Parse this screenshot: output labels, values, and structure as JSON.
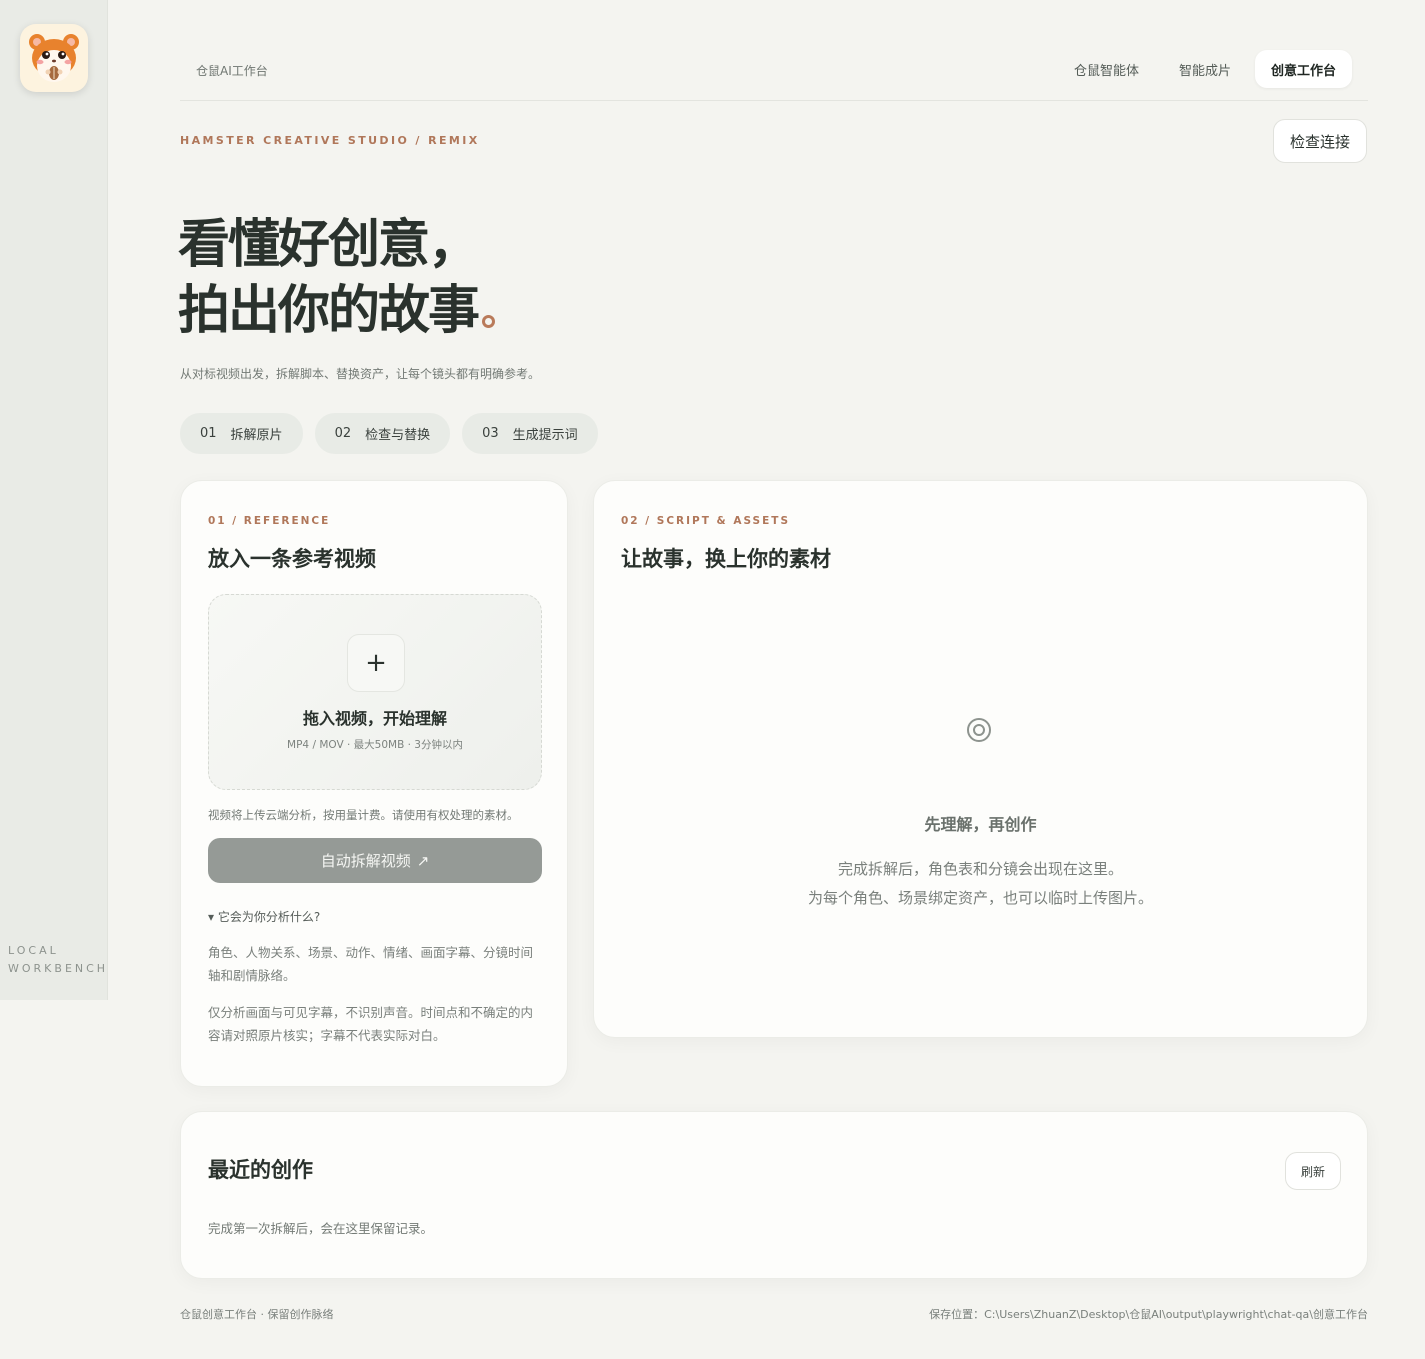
{
  "sidebar": {
    "logo_icon": "hamster-mascot-icon",
    "label_line1": "LOCAL",
    "label_line2": "WORKBENCH"
  },
  "topbar": {
    "brand": "仓鼠AI工作台",
    "nav": [
      {
        "label": "仓鼠智能体",
        "active": false
      },
      {
        "label": "智能成片",
        "active": false
      },
      {
        "label": "创意工作台",
        "active": true
      }
    ]
  },
  "header": {
    "eyebrow": "HAMSTER CREATIVE STUDIO / REMIX",
    "check_button": "检查连接",
    "hero_line1": "看懂好创意，",
    "hero_line2": "拍出你的故事",
    "subtitle": "从对标视频出发，拆解脚本、替换资产，让每个镜头都有明确参考。"
  },
  "steps": [
    {
      "num": "01",
      "label": "拆解原片"
    },
    {
      "num": "02",
      "label": "检查与替换"
    },
    {
      "num": "03",
      "label": "生成提示词"
    }
  ],
  "reference": {
    "eyebrow": "01 / REFERENCE",
    "title": "放入一条参考视频",
    "drop_icon": "plus-icon",
    "drop_plus": "+",
    "drop_title": "拖入视频，开始理解",
    "drop_hint": "MP4 / MOV · 最大50MB · 3分钟以内",
    "upload_note": "视频将上传云端分析，按用量计费。请使用有权处理的素材。",
    "analyze_button": "自动拆解视频",
    "analyze_icon_glyph": "↗",
    "details_toggle": "▾ 它会为你分析什么?",
    "para1": "角色、人物关系、场景、动作、情绪、画面字幕、分镜时间轴和剧情脉络。",
    "para2": "仅分析画面与可见字幕，不识别声音。时间点和不确定的内容请对照原片核实；字幕不代表实际对白。"
  },
  "script": {
    "eyebrow": "02 / SCRIPT & ASSETS",
    "title": "让故事，换上你的素材",
    "empty_icon": "target-icon",
    "empty_title": "先理解，再创作",
    "empty_line1": "完成拆解后，角色表和分镜会出现在这里。",
    "empty_line2": "为每个角色、场景绑定资产，也可以临时上传图片。"
  },
  "recent": {
    "title": "最近的创作",
    "refresh_button": "刷新",
    "empty": "完成第一次拆解后，会在这里保留记录。"
  },
  "footer": {
    "left": "仓鼠创意工作台 · 保留创作脉络",
    "right": "保存位置：C:\\Users\\ZhuanZ\\Desktop\\仓鼠AI\\output\\playwright\\chat-qa\\创意工作台"
  },
  "colors": {
    "accent": "#b0775a",
    "background": "#f4f4f0",
    "card": "#fdfdfb",
    "button_disabled": "#959a96"
  }
}
